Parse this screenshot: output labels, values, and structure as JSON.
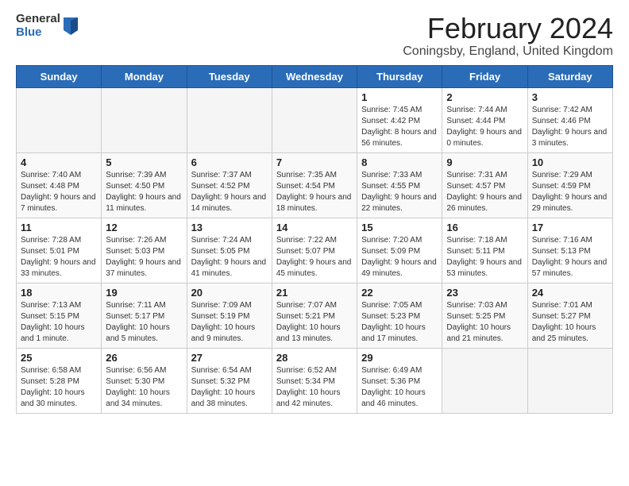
{
  "header": {
    "title": "February 2024",
    "subtitle": "Coningsby, England, United Kingdom",
    "logo_general": "General",
    "logo_blue": "Blue"
  },
  "weekdays": [
    "Sunday",
    "Monday",
    "Tuesday",
    "Wednesday",
    "Thursday",
    "Friday",
    "Saturday"
  ],
  "weeks": [
    [
      {
        "day": "",
        "info": ""
      },
      {
        "day": "",
        "info": ""
      },
      {
        "day": "",
        "info": ""
      },
      {
        "day": "",
        "info": ""
      },
      {
        "day": "1",
        "info": "Sunrise: 7:45 AM\nSunset: 4:42 PM\nDaylight: 8 hours and 56 minutes."
      },
      {
        "day": "2",
        "info": "Sunrise: 7:44 AM\nSunset: 4:44 PM\nDaylight: 9 hours and 0 minutes."
      },
      {
        "day": "3",
        "info": "Sunrise: 7:42 AM\nSunset: 4:46 PM\nDaylight: 9 hours and 3 minutes."
      }
    ],
    [
      {
        "day": "4",
        "info": "Sunrise: 7:40 AM\nSunset: 4:48 PM\nDaylight: 9 hours and 7 minutes."
      },
      {
        "day": "5",
        "info": "Sunrise: 7:39 AM\nSunset: 4:50 PM\nDaylight: 9 hours and 11 minutes."
      },
      {
        "day": "6",
        "info": "Sunrise: 7:37 AM\nSunset: 4:52 PM\nDaylight: 9 hours and 14 minutes."
      },
      {
        "day": "7",
        "info": "Sunrise: 7:35 AM\nSunset: 4:54 PM\nDaylight: 9 hours and 18 minutes."
      },
      {
        "day": "8",
        "info": "Sunrise: 7:33 AM\nSunset: 4:55 PM\nDaylight: 9 hours and 22 minutes."
      },
      {
        "day": "9",
        "info": "Sunrise: 7:31 AM\nSunset: 4:57 PM\nDaylight: 9 hours and 26 minutes."
      },
      {
        "day": "10",
        "info": "Sunrise: 7:29 AM\nSunset: 4:59 PM\nDaylight: 9 hours and 29 minutes."
      }
    ],
    [
      {
        "day": "11",
        "info": "Sunrise: 7:28 AM\nSunset: 5:01 PM\nDaylight: 9 hours and 33 minutes."
      },
      {
        "day": "12",
        "info": "Sunrise: 7:26 AM\nSunset: 5:03 PM\nDaylight: 9 hours and 37 minutes."
      },
      {
        "day": "13",
        "info": "Sunrise: 7:24 AM\nSunset: 5:05 PM\nDaylight: 9 hours and 41 minutes."
      },
      {
        "day": "14",
        "info": "Sunrise: 7:22 AM\nSunset: 5:07 PM\nDaylight: 9 hours and 45 minutes."
      },
      {
        "day": "15",
        "info": "Sunrise: 7:20 AM\nSunset: 5:09 PM\nDaylight: 9 hours and 49 minutes."
      },
      {
        "day": "16",
        "info": "Sunrise: 7:18 AM\nSunset: 5:11 PM\nDaylight: 9 hours and 53 minutes."
      },
      {
        "day": "17",
        "info": "Sunrise: 7:16 AM\nSunset: 5:13 PM\nDaylight: 9 hours and 57 minutes."
      }
    ],
    [
      {
        "day": "18",
        "info": "Sunrise: 7:13 AM\nSunset: 5:15 PM\nDaylight: 10 hours and 1 minute."
      },
      {
        "day": "19",
        "info": "Sunrise: 7:11 AM\nSunset: 5:17 PM\nDaylight: 10 hours and 5 minutes."
      },
      {
        "day": "20",
        "info": "Sunrise: 7:09 AM\nSunset: 5:19 PM\nDaylight: 10 hours and 9 minutes."
      },
      {
        "day": "21",
        "info": "Sunrise: 7:07 AM\nSunset: 5:21 PM\nDaylight: 10 hours and 13 minutes."
      },
      {
        "day": "22",
        "info": "Sunrise: 7:05 AM\nSunset: 5:23 PM\nDaylight: 10 hours and 17 minutes."
      },
      {
        "day": "23",
        "info": "Sunrise: 7:03 AM\nSunset: 5:25 PM\nDaylight: 10 hours and 21 minutes."
      },
      {
        "day": "24",
        "info": "Sunrise: 7:01 AM\nSunset: 5:27 PM\nDaylight: 10 hours and 25 minutes."
      }
    ],
    [
      {
        "day": "25",
        "info": "Sunrise: 6:58 AM\nSunset: 5:28 PM\nDaylight: 10 hours and 30 minutes."
      },
      {
        "day": "26",
        "info": "Sunrise: 6:56 AM\nSunset: 5:30 PM\nDaylight: 10 hours and 34 minutes."
      },
      {
        "day": "27",
        "info": "Sunrise: 6:54 AM\nSunset: 5:32 PM\nDaylight: 10 hours and 38 minutes."
      },
      {
        "day": "28",
        "info": "Sunrise: 6:52 AM\nSunset: 5:34 PM\nDaylight: 10 hours and 42 minutes."
      },
      {
        "day": "29",
        "info": "Sunrise: 6:49 AM\nSunset: 5:36 PM\nDaylight: 10 hours and 46 minutes."
      },
      {
        "day": "",
        "info": ""
      },
      {
        "day": "",
        "info": ""
      }
    ]
  ]
}
